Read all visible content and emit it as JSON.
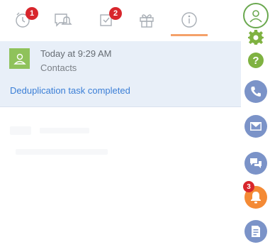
{
  "tabs": [
    {
      "name": "reminders",
      "icon": "alarm-clock-icon",
      "badge": "1"
    },
    {
      "name": "notifications-feed",
      "icon": "chat-bell-icon",
      "badge": ""
    },
    {
      "name": "tasks",
      "icon": "checkbox-icon",
      "badge": "2"
    },
    {
      "name": "celebrations",
      "icon": "gift-icon",
      "badge": ""
    },
    {
      "name": "system-notifications",
      "icon": "info-icon",
      "badge": "",
      "active": true
    }
  ],
  "notification": {
    "time": "Today at 9:29 AM",
    "source": "Contacts",
    "message": "Deduplication task completed",
    "avatar_icon": "contact-person-icon"
  },
  "sidebar": {
    "notifications_badge": "3",
    "items": [
      {
        "name": "profile",
        "icon": "user-profile-icon"
      },
      {
        "name": "settings",
        "icon": "gear-icon"
      },
      {
        "name": "help",
        "icon": "help-icon"
      },
      {
        "name": "phone",
        "icon": "phone-icon"
      },
      {
        "name": "email",
        "icon": "envelope-icon"
      },
      {
        "name": "feed",
        "icon": "chat-icon"
      },
      {
        "name": "notifications",
        "icon": "bell-icon"
      },
      {
        "name": "document",
        "icon": "document-icon"
      }
    ]
  },
  "colors": {
    "accent": "#f4a16a",
    "badge": "#d8262c",
    "link": "#3a7ed6",
    "card_bg": "#e8eff8",
    "sidebar_blue": "#7b93c8",
    "sidebar_orange": "#f48a35",
    "profile_green": "#6aa84f",
    "gear_green": "#7fb241"
  }
}
